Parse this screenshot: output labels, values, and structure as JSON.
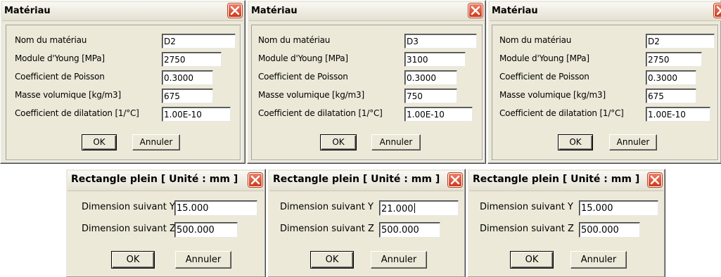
{
  "mat1": {
    "title": "Matériau",
    "labels": [
      "Nom du matériau",
      "Module d'Young [MPa]",
      "Coefficient de Poisson",
      "Masse volumique [kg/m3]",
      "Coefficient de dilatation [1/°C]"
    ],
    "values": [
      "D2",
      "2750",
      "0.3000",
      "675",
      "1.00E-10"
    ],
    "ok": "OK",
    "cancel": "Annuler"
  },
  "mat2": {
    "title": "Matériau",
    "labels": [
      "Nom du matériau",
      "Module d'Young [MPa]",
      "Coefficient de Poisson",
      "Masse volumique [kg/m3]",
      "Coefficient de dilatation [1/°C]"
    ],
    "values": [
      "D3",
      "3100",
      "0.3000",
      "750",
      "1.00E-10"
    ],
    "ok": "OK",
    "cancel": "Annuler"
  },
  "mat3": {
    "title": "Matériau",
    "labels": [
      "Nom du matériau",
      "Module d'Young [MPa]",
      "Coefficient de Poisson",
      "Masse volumique [kg/m3]",
      "Coefficient de dilatation [1/°C]"
    ],
    "values": [
      "D2",
      "2750",
      "0.3000",
      "675",
      "1.00E-10"
    ],
    "ok": "OK",
    "cancel": "Annuler"
  },
  "rect1": {
    "title": "Rectangle plein [ Unité :  mm ]",
    "labels": [
      "Dimension suivant Y",
      "Dimension suivant Z"
    ],
    "values": [
      "15.000",
      "500.000"
    ],
    "ok": "OK",
    "cancel": "Annuler"
  },
  "rect2": {
    "title": "Rectangle plein [ Unité :  mm ]",
    "labels": [
      "Dimension suivant Y",
      "Dimension suivant Z"
    ],
    "values": [
      "21.000",
      "500.000"
    ],
    "ok": "OK",
    "cancel": "Annuler"
  },
  "rect3": {
    "title": "Rectangle plein [ Unité :  mm ]",
    "labels": [
      "Dimension suivant Y",
      "Dimension suivant Z"
    ],
    "values": [
      "15.000",
      "500.000"
    ],
    "ok": "OK",
    "cancel": "Annuler"
  },
  "icons": {
    "close": "close-icon"
  },
  "colors": {
    "dialog_bg": "#ece9d8",
    "close_red": "#cf3818"
  }
}
